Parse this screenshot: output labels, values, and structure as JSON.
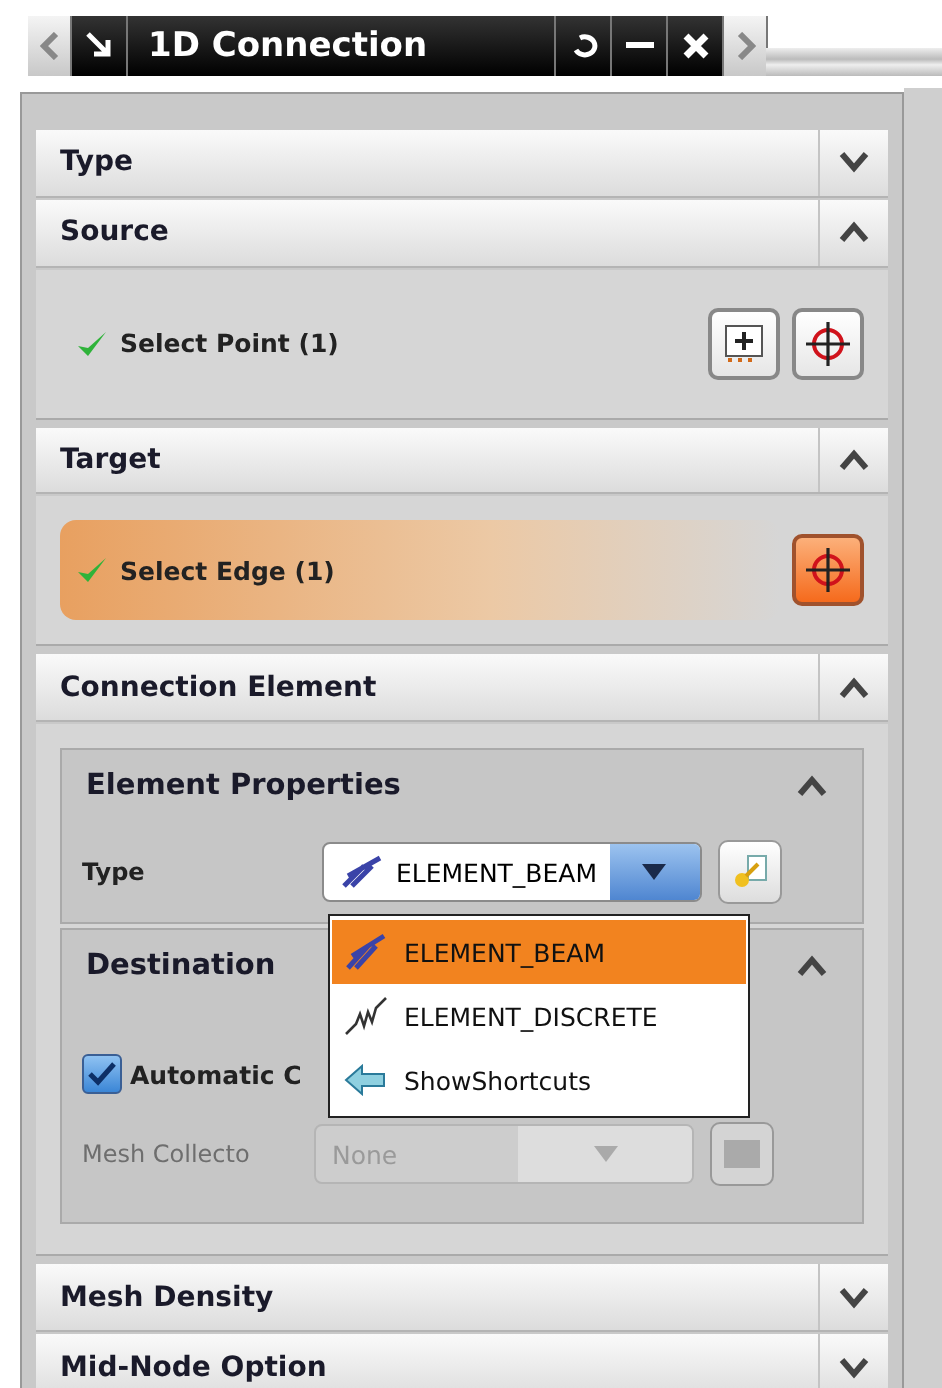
{
  "window": {
    "title": "1D Connection"
  },
  "sections": [
    {
      "kind": "plain",
      "title": "Type",
      "expanded": false
    },
    {
      "kind": "selection",
      "title": "Source",
      "expanded": true,
      "label": "Select Point (1)",
      "active": false,
      "add_button": true
    },
    {
      "kind": "selection",
      "title": "Target",
      "expanded": true,
      "label": "Select Edge (1)",
      "active": true,
      "add_button": false
    },
    {
      "kind": "groups",
      "title": "Connection Element",
      "expanded": true,
      "groups": [
        {
          "kind": "type",
          "title": "Element Properties",
          "expanded": true,
          "label": "Type",
          "value": "ELEMENT_BEAM"
        },
        {
          "kind": "destination",
          "title": "Destination",
          "expanded": true,
          "checkbox": {
            "label": "Automatic C",
            "checked": true
          },
          "field": {
            "label": "Mesh Collecto",
            "value": "None",
            "disabled": true
          }
        }
      ]
    },
    {
      "kind": "plain",
      "title": "Mesh Density",
      "expanded": false
    },
    {
      "kind": "plain",
      "title": "Mid-Node Option",
      "expanded": false
    }
  ],
  "dropdown": {
    "items": [
      {
        "kind": "beam",
        "label": "ELEMENT_BEAM",
        "selected": true
      },
      {
        "kind": "discrete",
        "label": "ELEMENT_DISCRETE",
        "selected": false
      },
      {
        "kind": "shortcuts",
        "label": "ShowShortcuts",
        "selected": false
      }
    ]
  }
}
